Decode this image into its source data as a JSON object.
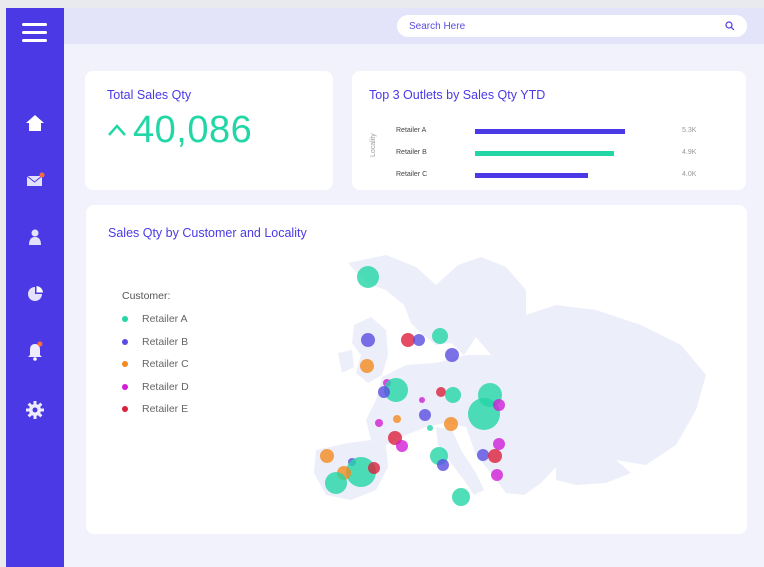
{
  "search": {
    "placeholder": "Search Here"
  },
  "kpi": {
    "title": "Total Sales Qty",
    "value": "40,086"
  },
  "top_outlets": {
    "title": "Top 3 Outlets by Sales Qty YTD",
    "axis_label": "Locality",
    "rows": [
      {
        "label": "Retailer A",
        "value_label": "5.3K",
        "value": 5.3,
        "color": "#4b39e6"
      },
      {
        "label": "Retailer B",
        "value_label": "4.9K",
        "value": 4.9,
        "color": "#23d6a6"
      },
      {
        "label": "Retailer C",
        "value_label": "4.0K",
        "value": 4.0,
        "color": "#4b39e6"
      }
    ]
  },
  "map_card": {
    "title": "Sales Qty by Customer and Locality",
    "legend_title": "Customer:",
    "legend": [
      {
        "label": "Retailer A",
        "color": "#23d6a6"
      },
      {
        "label": "Retailer B",
        "color": "#5a4de0"
      },
      {
        "label": "Retailer C",
        "color": "#f48a1f"
      },
      {
        "label": "Retailer D",
        "color": "#d11ed6"
      },
      {
        "label": "Retailer E",
        "color": "#dc1f3c"
      }
    ]
  },
  "colors": {
    "accent": "#4b39e6",
    "positive": "#23d6a6"
  },
  "icons": [
    "menu-icon",
    "home-icon",
    "mail-icon",
    "user-icon",
    "pie-chart-icon",
    "bell-icon",
    "gear-icon",
    "search-icon",
    "up-arrow-icon"
  ]
}
